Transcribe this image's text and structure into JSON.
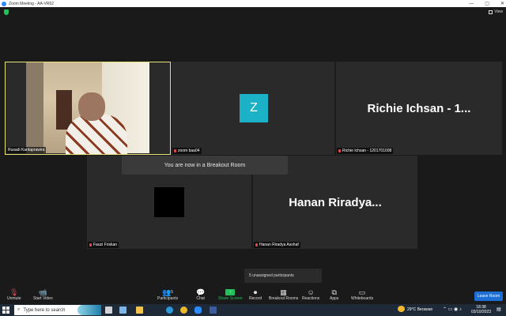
{
  "window": {
    "title": "Zoom Meeting - AA-VR62",
    "controls": [
      "—",
      "▢",
      "✕"
    ]
  },
  "topbar": {
    "view_label": "View"
  },
  "tiles": [
    {
      "name": "Rusadi Kantaprawira",
      "muted": false,
      "active": true,
      "display": "video"
    },
    {
      "name": "zoom baa04",
      "muted": true,
      "display": "avatar",
      "avatar_letter": "Z",
      "avatar_color": "#1bb1c6"
    },
    {
      "name": "Richie Ichsan - 1201701008",
      "muted": true,
      "display": "name",
      "big_name": "Richie Ichsan - 1..."
    },
    {
      "name": "Fauzi Friskan",
      "muted": true,
      "display": "black"
    },
    {
      "name": "Hanan Riradya Asshaf",
      "muted": true,
      "display": "name",
      "big_name": "Hanan  Riradya..."
    }
  ],
  "banner": "You are now in a Breakout Room",
  "unassigned": "5 unassigned participants",
  "toolbar": {
    "unmute": "Unmute",
    "start_video": "Start Video",
    "participants": "Participants",
    "participants_count": "5",
    "chat": "Chat",
    "share_screen": "Share Screen",
    "record": "Record",
    "breakout_rooms": "Breakout Rooms",
    "reactions": "Reactions",
    "apps": "Apps",
    "whiteboards": "Whiteboards",
    "leave": "Leave Room"
  },
  "taskbar": {
    "search_placeholder": "Type here to search",
    "temperature": "29°C",
    "weather": "Berawan",
    "time": "18:38",
    "date": "03/10/2023"
  },
  "colors": {
    "active_border": "#e6e27a",
    "accent": "#2d8cff",
    "leave": "#1d6fd6",
    "share": "#23c05c",
    "muted_icon": "#e0474c"
  }
}
